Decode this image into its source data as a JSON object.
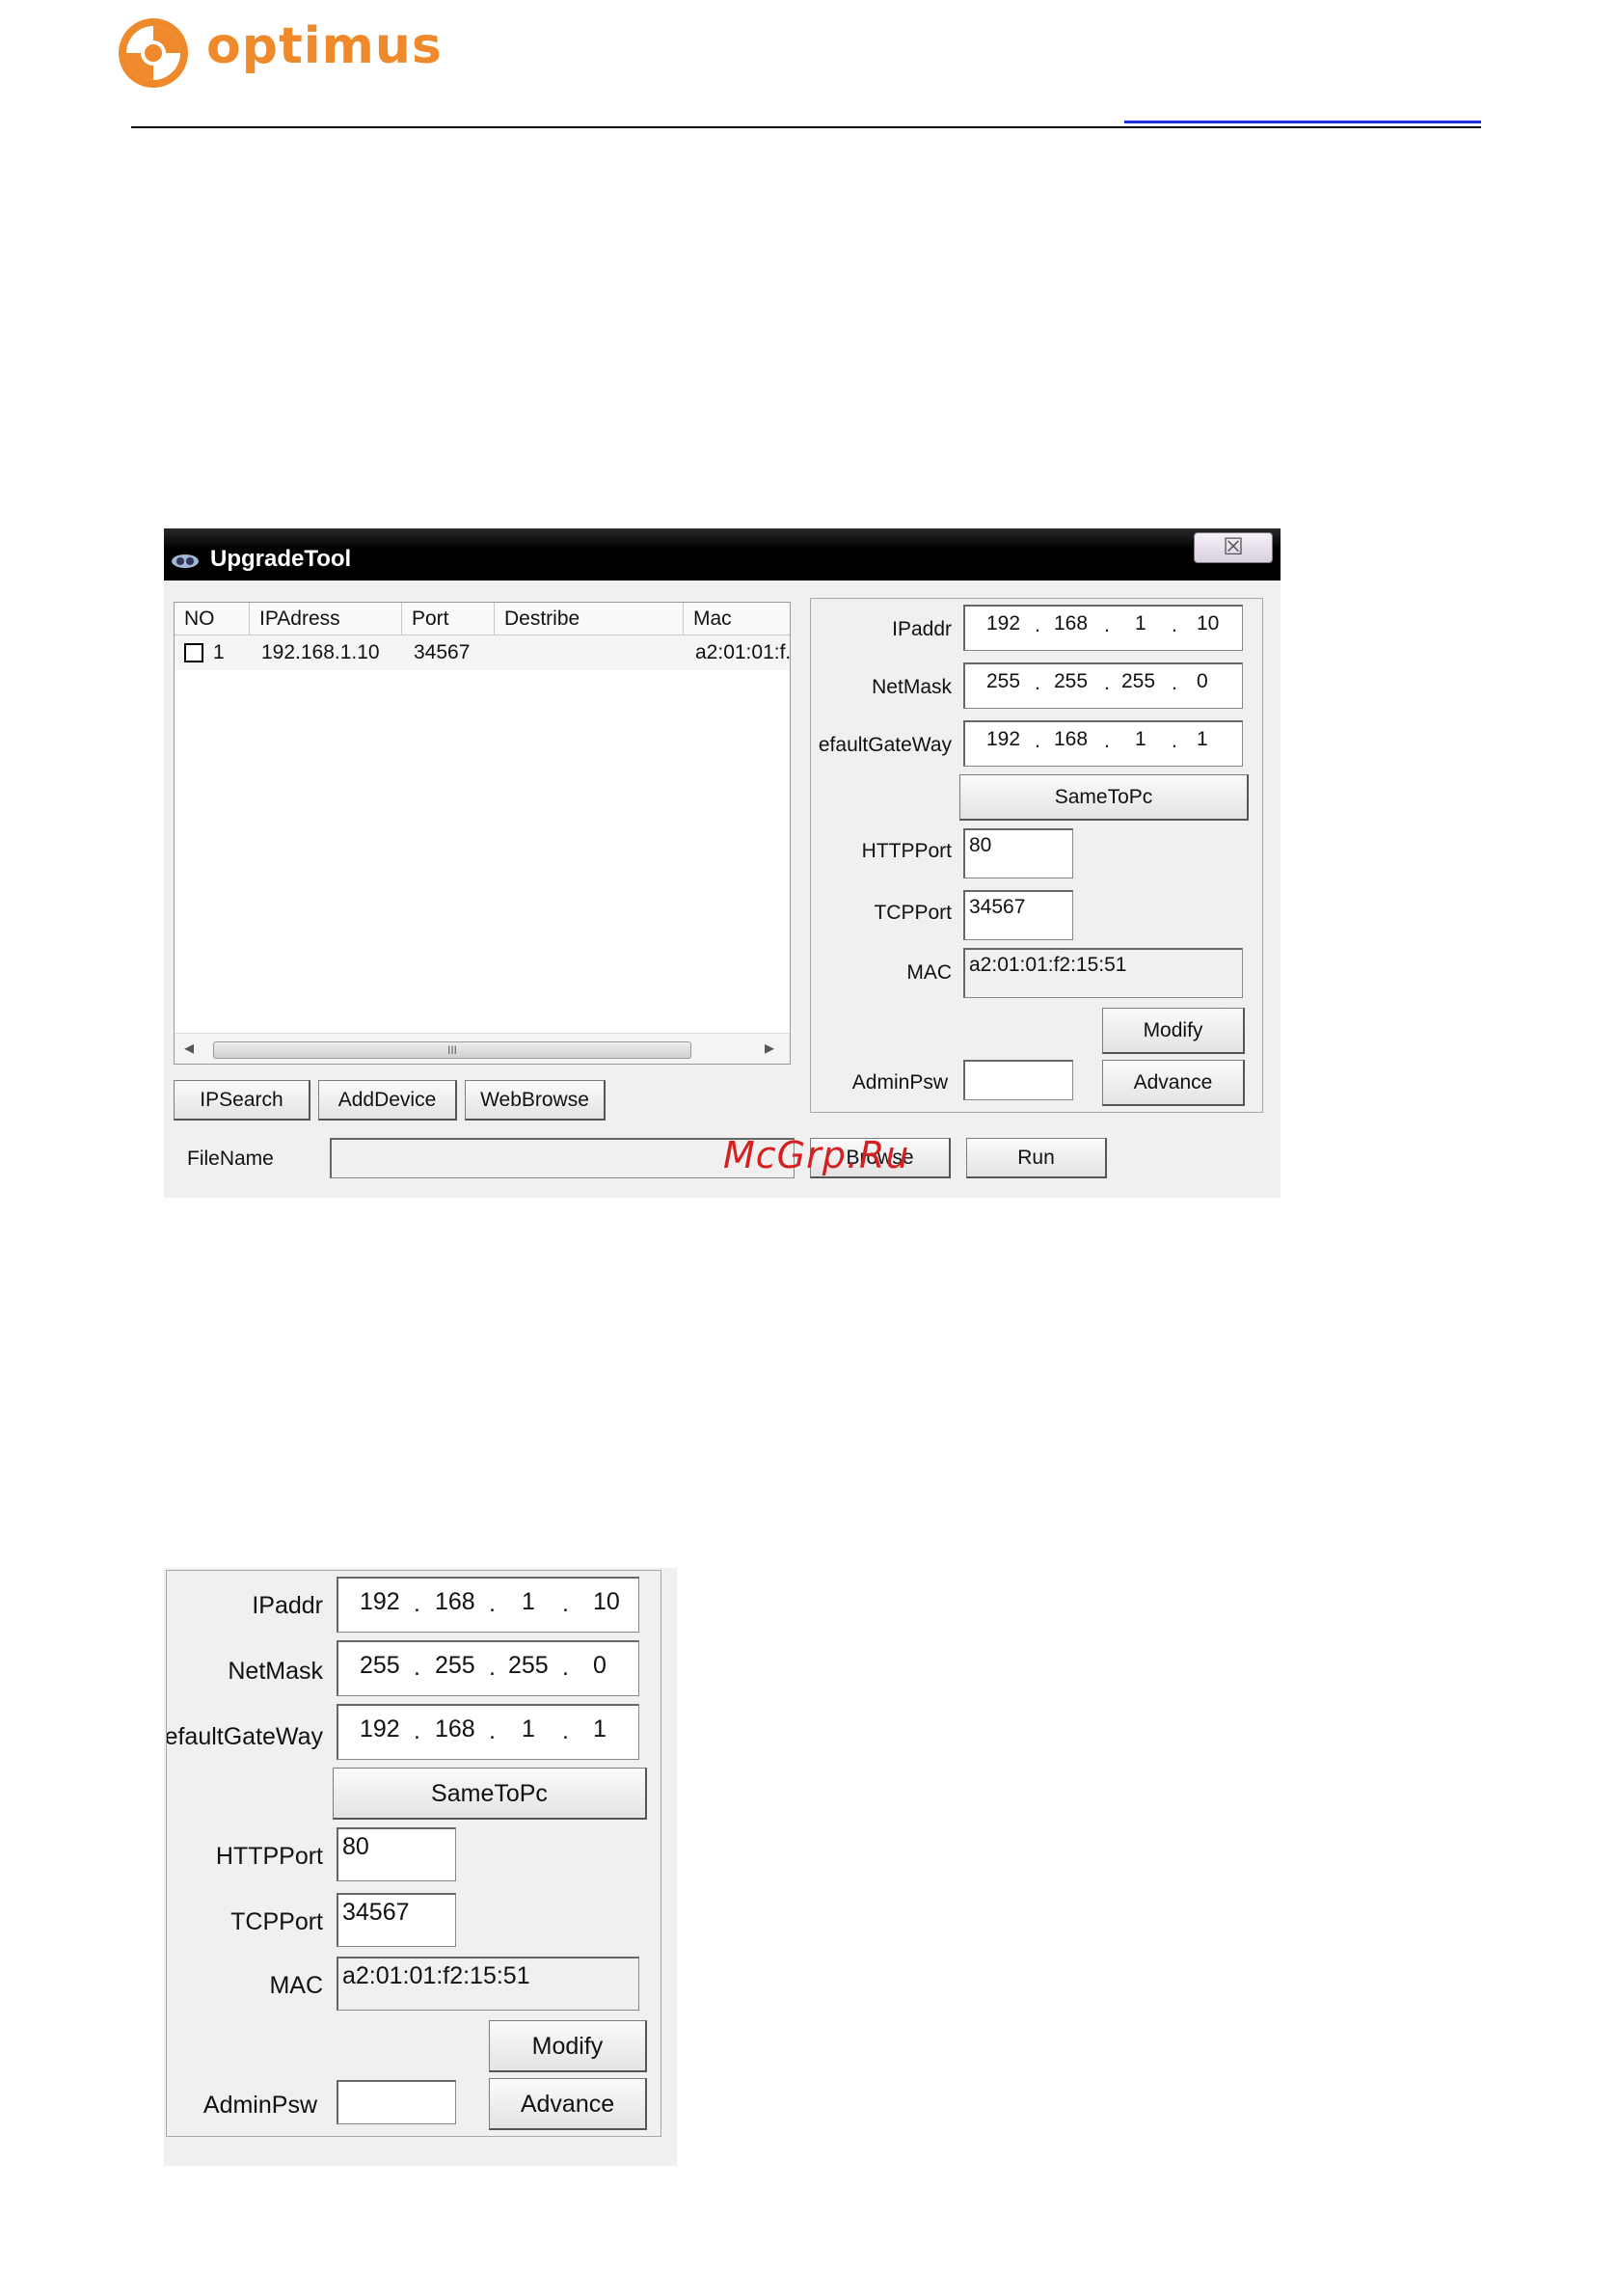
{
  "header": {
    "brand": "optimus",
    "brand_color": "#ef8a2c",
    "link_color": "#1d2fd6"
  },
  "window": {
    "title": "UpgradeTool",
    "close_glyph": "☒",
    "columns": [
      "NO",
      "IPAdress",
      "Port",
      "Destribe",
      "Mac"
    ],
    "rows": [
      {
        "no": "1",
        "ip": "192.168.1.10",
        "port": "34567",
        "describe": "",
        "mac": "a2:01:01:f."
      }
    ],
    "scroll_thumb_label": "III",
    "scroll_left": "◂",
    "scroll_right": "▸",
    "buttons": {
      "ipsearch": "IPSearch",
      "adddevice": "AddDevice",
      "webbrowse": "WebBrowse",
      "browse": "Browse",
      "run": "Run"
    },
    "filename_label": "FileName"
  },
  "settings": {
    "ipaddr_label": "IPaddr",
    "ipaddr": [
      "192",
      "168",
      "1",
      "10"
    ],
    "netmask_label": "NetMask",
    "netmask": [
      "255",
      "255",
      "255",
      "0"
    ],
    "gateway_label": "efaultGateWay",
    "gateway": [
      "192",
      "168",
      "1",
      "1"
    ],
    "sametopc": "SameToPc",
    "httpport_label": "HTTPPort",
    "httpport": "80",
    "tcpport_label": "TCPPort",
    "tcpport": "34567",
    "mac_label": "MAC",
    "mac": "a2:01:01:f2:15:51",
    "modify": "Modify",
    "adminpsw_label": "AdminPsw",
    "advance": "Advance"
  },
  "watermark": "McGrp.Ru"
}
